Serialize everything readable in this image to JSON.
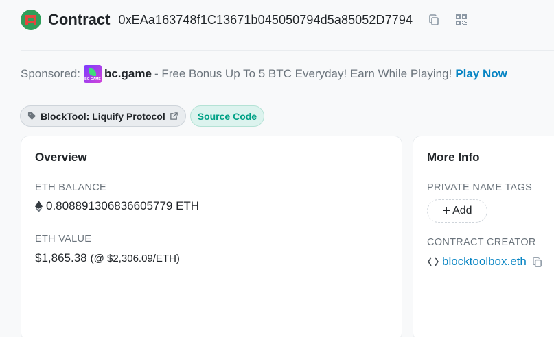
{
  "header": {
    "title": "Contract",
    "address": "0xEAa163748f1C13671b045050794d5a85052D7794",
    "icons": [
      "copy-icon",
      "qr-code-icon"
    ]
  },
  "sponsor": {
    "prefix": "Sponsored:",
    "brand": "bc.game",
    "logo_text": "BC GAME",
    "message": "- Free Bonus Up To 5 BTC Everyday! Earn While Playing!",
    "cta": "Play Now"
  },
  "tags": {
    "blocktool": "BlockTool: Liquify Protocol",
    "source": "Source Code"
  },
  "overview": {
    "title": "Overview",
    "eth_balance_label": "ETH BALANCE",
    "eth_balance_value": "0.808891306836605779 ETH",
    "eth_value_label": "ETH VALUE",
    "eth_value_amount": "$1,865.38",
    "eth_value_rate": "(@ $2,306.09/ETH)"
  },
  "more_info": {
    "title": "More Info",
    "private_tags_label": "PRIVATE NAME TAGS",
    "add_label": "Add",
    "creator_label": "CONTRACT CREATOR",
    "creator_value": "blocktoolbox.eth"
  },
  "colors": {
    "link": "#0784c3",
    "source_badge_text": "#00a186",
    "avatar_green": "#2f9e5a",
    "avatar_red": "#e2463f"
  }
}
